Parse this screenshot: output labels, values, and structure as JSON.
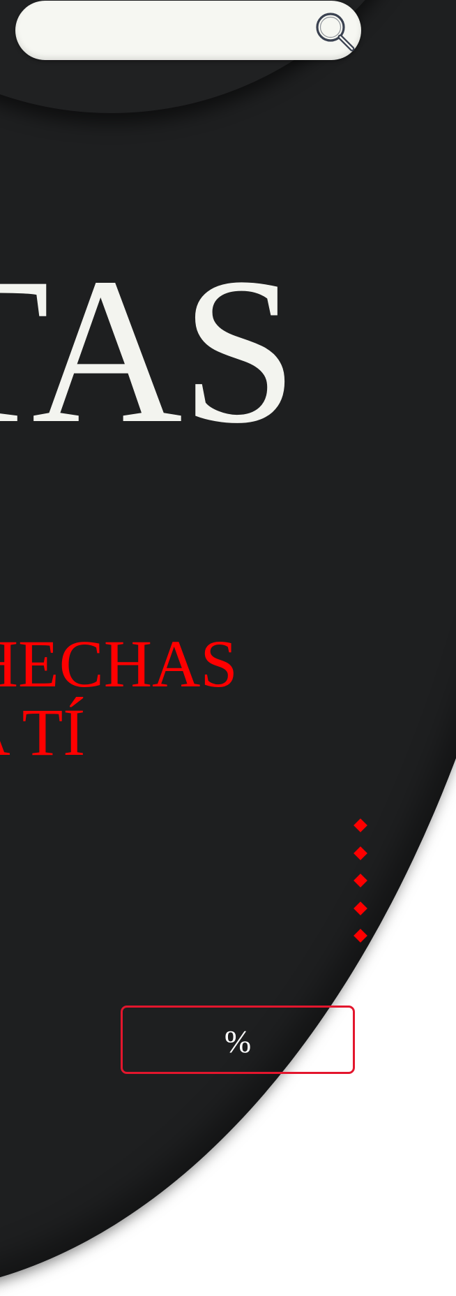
{
  "colors": {
    "background": "#1e1f20",
    "page_edge": "#ffffff",
    "search_bar": "#f6f7f2",
    "hero_text": "#f3f4ef",
    "accent_red": "#ff0000",
    "button_border": "#e3162d",
    "button_text": "#ffffff"
  },
  "search": {
    "value": "",
    "placeholder": "",
    "icon": "search-icon"
  },
  "hero": {
    "title": "TAS"
  },
  "subtitle": {
    "line1": "AS HECHAS",
    "line2": "ARA TÍ"
  },
  "carousel": {
    "dot_icon": "diamond-icon",
    "dot_count": 5
  },
  "offer_button": {
    "label": "%"
  }
}
